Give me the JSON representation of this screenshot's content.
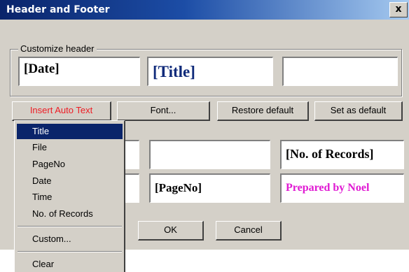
{
  "window": {
    "title": "Header and Footer",
    "close_glyph": "x"
  },
  "header": {
    "group_label": "Customize header",
    "left": "[Date]",
    "center": "[Title]",
    "right": ""
  },
  "footer": {
    "row1": {
      "left": "",
      "center": "",
      "right": "[No. of Records]"
    },
    "row2": {
      "left": "",
      "center": "[PageNo]",
      "right": "Prepared by Noel"
    }
  },
  "toolbar": {
    "insert_auto_text": "Insert Auto Text",
    "font": "Font...",
    "restore_default": "Restore default",
    "set_as_default": "Set as default"
  },
  "dialog_buttons": {
    "ok": "OK",
    "cancel": "Cancel"
  },
  "menu": {
    "items": [
      {
        "label": "Title",
        "selected": true
      },
      {
        "label": "File"
      },
      {
        "label": "PageNo"
      },
      {
        "label": "Date"
      },
      {
        "label": "Time"
      },
      {
        "label": "No. of Records"
      },
      {
        "label": "Custom..."
      },
      {
        "label": "Clear"
      }
    ]
  },
  "colors": {
    "title_text": "#0f2a7a",
    "prepared_by_text": "#e01ad3",
    "insert_auto_text": "#ee1c24",
    "selection": "#0a246a"
  }
}
